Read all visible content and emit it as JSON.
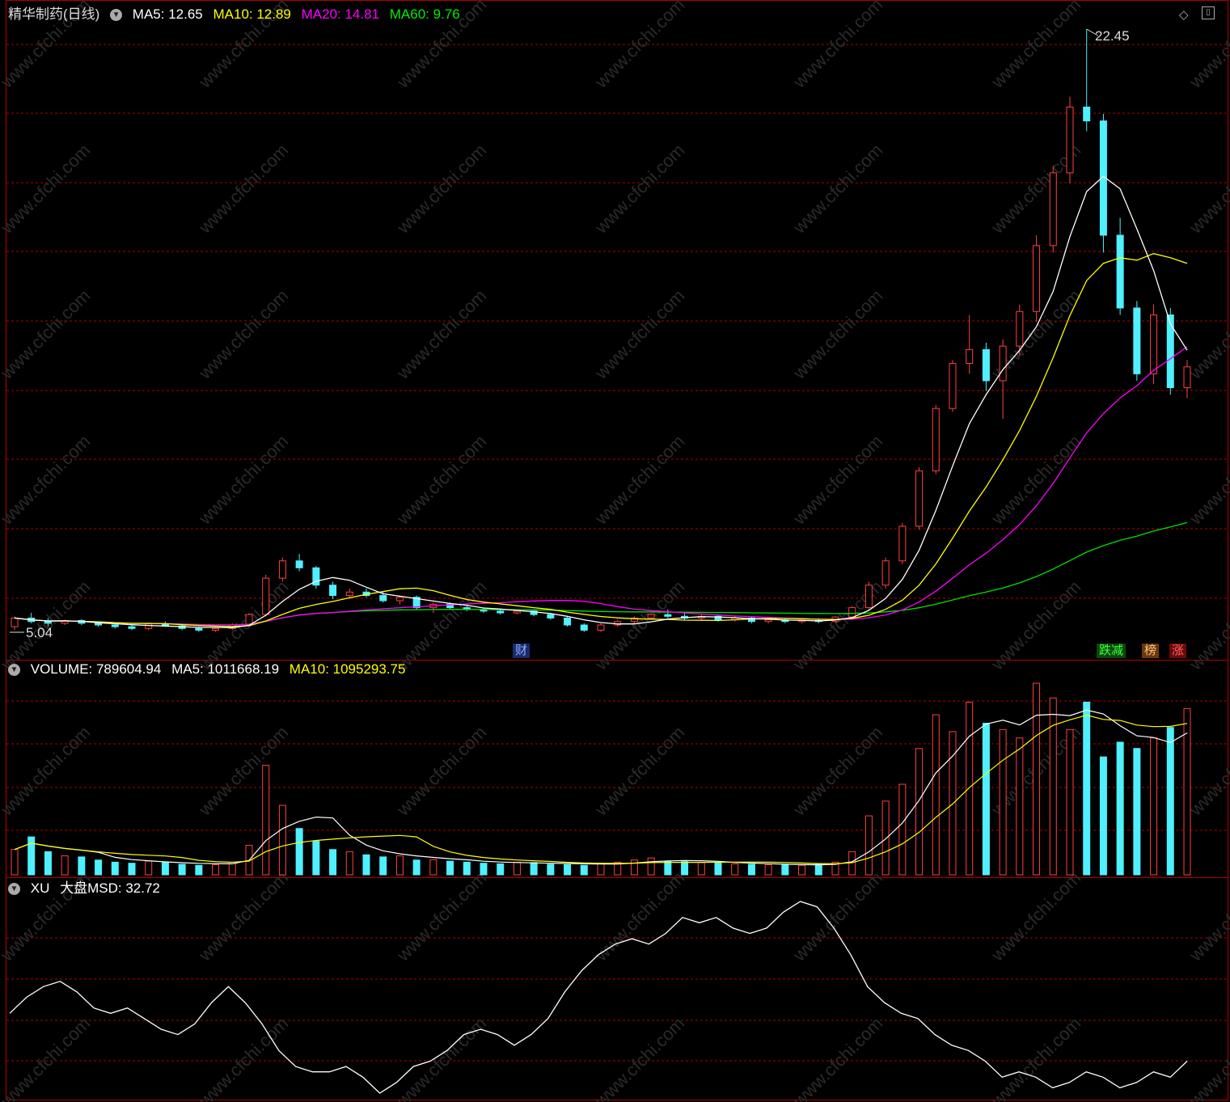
{
  "header": {
    "title": "精华制药(日线)",
    "ma": [
      {
        "label": "MA5: 12.65",
        "color": "#ffffff"
      },
      {
        "label": "MA10: 12.89",
        "color": "#ffff00"
      },
      {
        "label": "MA20: 14.81",
        "color": "#ff00ff"
      },
      {
        "label": "MA60: 9.76",
        "color": "#00e000"
      }
    ]
  },
  "volume_panel": {
    "items": [
      {
        "label": "VOLUME: 789604.94",
        "color": "#ffffff"
      },
      {
        "label": "MA5: 1011668.19",
        "color": "#ffffff"
      },
      {
        "label": "MA10: 1095293.75",
        "color": "#ffff00"
      }
    ]
  },
  "xu_panel": {
    "items": [
      {
        "label": "XU",
        "color": "#ffffff"
      },
      {
        "label": "大盘MSD: 32.72",
        "color": "#ffffff"
      }
    ]
  },
  "annotations": {
    "high_label": "22.45",
    "low_label": "5.04",
    "tag_cai": "财",
    "tag_diejian": "跌减",
    "tag_bang": "榜",
    "tag_zhang": "涨",
    "watermark": "www.cfchi.com"
  },
  "colors": {
    "up": "#ff4040",
    "down": "#4ff0ff",
    "grid": "#b00000",
    "ma5": "#ffffff",
    "ma10": "#ffff00",
    "ma20": "#ff00ff",
    "ma60": "#00e000"
  },
  "chart_data": [
    {
      "type": "candlestick",
      "name": "price",
      "high": 22.45,
      "low": 5.04,
      "candles": [
        [
          5.2,
          5.5,
          5.1,
          5.45
        ],
        [
          5.45,
          5.6,
          5.3,
          5.35
        ],
        [
          5.35,
          5.45,
          5.2,
          5.3
        ],
        [
          5.3,
          5.4,
          5.25,
          5.38
        ],
        [
          5.38,
          5.42,
          5.25,
          5.3
        ],
        [
          5.3,
          5.35,
          5.2,
          5.25
        ],
        [
          5.25,
          5.3,
          5.15,
          5.2
        ],
        [
          5.2,
          5.25,
          5.1,
          5.15
        ],
        [
          5.15,
          5.3,
          5.1,
          5.28
        ],
        [
          5.28,
          5.35,
          5.2,
          5.22
        ],
        [
          5.22,
          5.28,
          5.1,
          5.15
        ],
        [
          5.15,
          5.2,
          5.05,
          5.1
        ],
        [
          5.1,
          5.18,
          5.05,
          5.15
        ],
        [
          5.15,
          5.3,
          5.1,
          5.25
        ],
        [
          5.25,
          5.6,
          5.2,
          5.55
        ],
        [
          5.55,
          6.7,
          5.5,
          6.6
        ],
        [
          6.6,
          7.2,
          6.5,
          7.1
        ],
        [
          7.1,
          7.3,
          6.8,
          6.9
        ],
        [
          6.9,
          6.95,
          6.3,
          6.4
        ],
        [
          6.4,
          6.5,
          6.0,
          6.1
        ],
        [
          6.1,
          6.3,
          6.0,
          6.2
        ],
        [
          6.2,
          6.3,
          6.05,
          6.1
        ],
        [
          6.1,
          6.2,
          5.9,
          5.95
        ],
        [
          5.95,
          6.1,
          5.85,
          6.05
        ],
        [
          6.05,
          6.1,
          5.7,
          5.75
        ],
        [
          5.75,
          5.9,
          5.6,
          5.85
        ],
        [
          5.85,
          5.9,
          5.7,
          5.75
        ],
        [
          5.75,
          5.8,
          5.65,
          5.7
        ],
        [
          5.7,
          5.75,
          5.6,
          5.65
        ],
        [
          5.65,
          5.7,
          5.55,
          5.6
        ],
        [
          5.6,
          5.7,
          5.55,
          5.65
        ],
        [
          5.65,
          5.7,
          5.5,
          5.55
        ],
        [
          5.55,
          5.6,
          5.4,
          5.45
        ],
        [
          5.45,
          5.5,
          5.2,
          5.25
        ],
        [
          5.25,
          5.3,
          5.05,
          5.1
        ],
        [
          5.1,
          5.3,
          5.05,
          5.25
        ],
        [
          5.25,
          5.4,
          5.2,
          5.35
        ],
        [
          5.35,
          5.5,
          5.3,
          5.45
        ],
        [
          5.45,
          5.6,
          5.4,
          5.55
        ],
        [
          5.55,
          5.7,
          5.45,
          5.5
        ],
        [
          5.5,
          5.6,
          5.4,
          5.45
        ],
        [
          5.45,
          5.55,
          5.4,
          5.5
        ],
        [
          5.5,
          5.55,
          5.35,
          5.4
        ],
        [
          5.4,
          5.5,
          5.35,
          5.45
        ],
        [
          5.45,
          5.5,
          5.3,
          5.35
        ],
        [
          5.35,
          5.45,
          5.3,
          5.4
        ],
        [
          5.4,
          5.45,
          5.3,
          5.35
        ],
        [
          5.35,
          5.4,
          5.3,
          5.38
        ],
        [
          5.38,
          5.45,
          5.3,
          5.35
        ],
        [
          5.35,
          5.5,
          5.3,
          5.48
        ],
        [
          5.48,
          5.8,
          5.45,
          5.75
        ],
        [
          5.75,
          6.5,
          5.7,
          6.4
        ],
        [
          6.4,
          7.2,
          6.3,
          7.1
        ],
        [
          7.1,
          8.2,
          7.0,
          8.1
        ],
        [
          8.1,
          9.8,
          8.0,
          9.7
        ],
        [
          9.7,
          11.6,
          9.6,
          11.5
        ],
        [
          11.5,
          12.9,
          11.4,
          12.8
        ],
        [
          12.8,
          14.2,
          12.5,
          13.2
        ],
        [
          13.2,
          13.4,
          12.0,
          12.3
        ],
        [
          12.3,
          13.5,
          11.2,
          13.3
        ],
        [
          13.3,
          14.5,
          13.0,
          14.3
        ],
        [
          14.3,
          16.5,
          14.0,
          16.2
        ],
        [
          16.2,
          18.5,
          16.0,
          18.3
        ],
        [
          18.3,
          20.5,
          18.0,
          20.2
        ],
        [
          20.2,
          22.45,
          19.5,
          19.8
        ],
        [
          19.8,
          20.0,
          16.0,
          16.5
        ],
        [
          16.5,
          17.0,
          14.2,
          14.4
        ],
        [
          14.4,
          14.6,
          12.3,
          12.5
        ],
        [
          12.5,
          14.5,
          12.2,
          14.2
        ],
        [
          14.2,
          14.4,
          11.9,
          12.1
        ],
        [
          12.1,
          12.9,
          11.8,
          12.7
        ]
      ]
    },
    {
      "type": "bar",
      "name": "volume",
      "values": [
        120000,
        180000,
        110000,
        90000,
        85000,
        70000,
        60000,
        55000,
        65000,
        58000,
        50000,
        45000,
        48000,
        60000,
        140000,
        520000,
        330000,
        220000,
        160000,
        120000,
        110000,
        95000,
        85000,
        90000,
        70000,
        72000,
        65000,
        60000,
        55000,
        52000,
        60000,
        58000,
        50000,
        48000,
        45000,
        55000,
        60000,
        70000,
        80000,
        65000,
        62000,
        58000,
        56000,
        52000,
        50000,
        48000,
        46000,
        45000,
        50000,
        60000,
        110000,
        280000,
        350000,
        430000,
        600000,
        760000,
        680000,
        820000,
        720000,
        690000,
        650000,
        910000,
        840000,
        690000,
        820000,
        560000,
        630000,
        600000,
        650000,
        700000,
        789604.94
      ]
    },
    {
      "type": "line",
      "name": "MSD",
      "last": 32.72
    }
  ]
}
